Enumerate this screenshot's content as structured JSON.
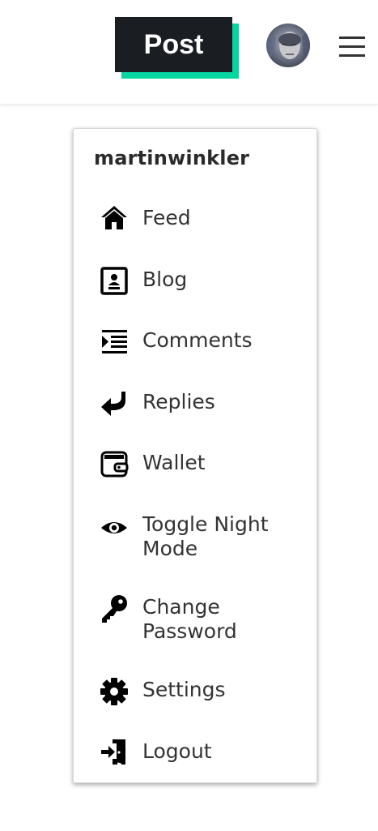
{
  "header": {
    "post_label": "Post",
    "accent_color": "#06d6a0",
    "button_color": "#1a1e23"
  },
  "user_menu": {
    "username": "martinwinkler",
    "items": [
      {
        "label": "Feed",
        "icon": "home-icon"
      },
      {
        "label": "Blog",
        "icon": "blog-icon"
      },
      {
        "label": "Comments",
        "icon": "comments-icon"
      },
      {
        "label": "Replies",
        "icon": "reply-icon"
      },
      {
        "label": "Wallet",
        "icon": "wallet-icon"
      },
      {
        "label": "Toggle Night Mode",
        "icon": "eye-icon"
      },
      {
        "label": "Change Password",
        "icon": "key-icon"
      },
      {
        "label": "Settings",
        "icon": "gear-icon"
      },
      {
        "label": "Logout",
        "icon": "logout-icon"
      }
    ]
  }
}
